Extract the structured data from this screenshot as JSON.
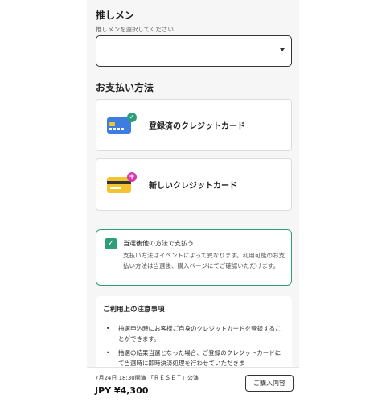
{
  "member_section": {
    "title": "推しメン",
    "subtitle": "推しメンを選択してください",
    "select_value": ""
  },
  "payment_section": {
    "title": "お支払い方法",
    "options": [
      {
        "label": "登録済のクレジットカード",
        "icon": "registered-card-icon"
      },
      {
        "label": "新しいクレジットカード",
        "icon": "new-card-icon"
      }
    ]
  },
  "notice": {
    "title": "当選後他の方法で支払う",
    "body": "支払い方法はイベントによって異なります。利用可能のお支払い方法は当選後、購入ページにてご確認いただけます。"
  },
  "terms": {
    "title": "ご利用上の注意事項",
    "items": [
      "抽選申込時にお客様ご自身のクレジットカードを登録することができます。",
      "抽選の結果当選となった場合、ご登録のクレジットカードにて当選時に即時決済処理を行わせていただきま"
    ]
  },
  "footer": {
    "event": "7月24日 18:30開演 「ＲＥＳＥＴ」公演",
    "price": "JPY ¥4,300",
    "button_label": "ご購入内容"
  },
  "colors": {
    "accent_green": "#2e9e7a",
    "card_blue": "#3d7de0",
    "card_yellow": "#f4c430",
    "badge_pink": "#d63ab0"
  }
}
